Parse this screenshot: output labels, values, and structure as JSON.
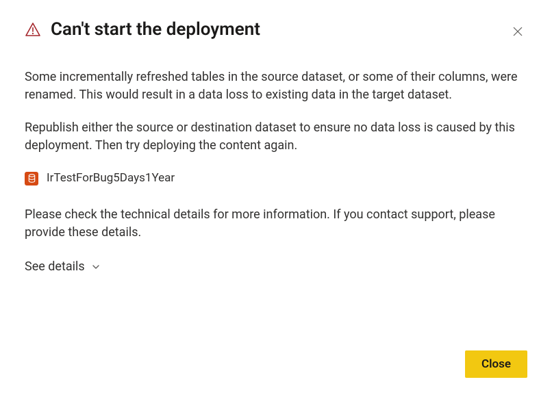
{
  "dialog": {
    "title": "Can't start the deployment",
    "paragraph1": "Some incrementally refreshed tables in the source dataset, or some of their columns, were renamed. This would result in a data loss to existing data in the target dataset.",
    "paragraph2": "Republish either the source or destination dataset to ensure no data loss is caused by this deployment. Then try deploying the content again.",
    "dataset": {
      "name": "IrTestForBug5Days1Year",
      "icon": "dataset-icon"
    },
    "paragraph3": "Please check the technical details for more information. If you contact support, please provide these details.",
    "see_details_label": "See details",
    "close_button_label": "Close",
    "colors": {
      "warning": "#a4262c",
      "primary_button": "#f2c811",
      "dataset_icon_bg": "#d64a13"
    }
  }
}
